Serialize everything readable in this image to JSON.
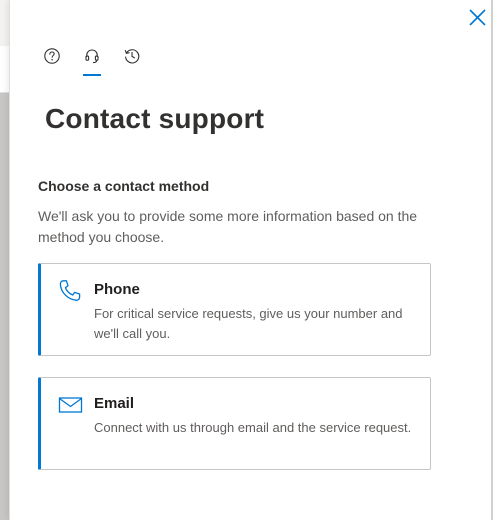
{
  "panel": {
    "close_icon": "close-icon",
    "tabs": [
      {
        "icon": "help-icon",
        "selected": false
      },
      {
        "icon": "headset-icon",
        "selected": true
      },
      {
        "icon": "history-icon",
        "selected": false
      }
    ]
  },
  "page": {
    "title": "Contact support"
  },
  "contact": {
    "heading": "Choose a contact method",
    "description": "We'll ask you to provide some more information based on the method you choose.",
    "methods": [
      {
        "icon": "phone-icon",
        "title": "Phone",
        "description": "For critical service requests, give us your number and we'll call you."
      },
      {
        "icon": "mail-icon",
        "title": "Email",
        "description": "Connect with us through email and the service request."
      }
    ]
  },
  "colors": {
    "accent": "#0078d4",
    "text_primary": "#323130",
    "text_secondary": "#605e5c",
    "border": "#c8c6c4"
  }
}
